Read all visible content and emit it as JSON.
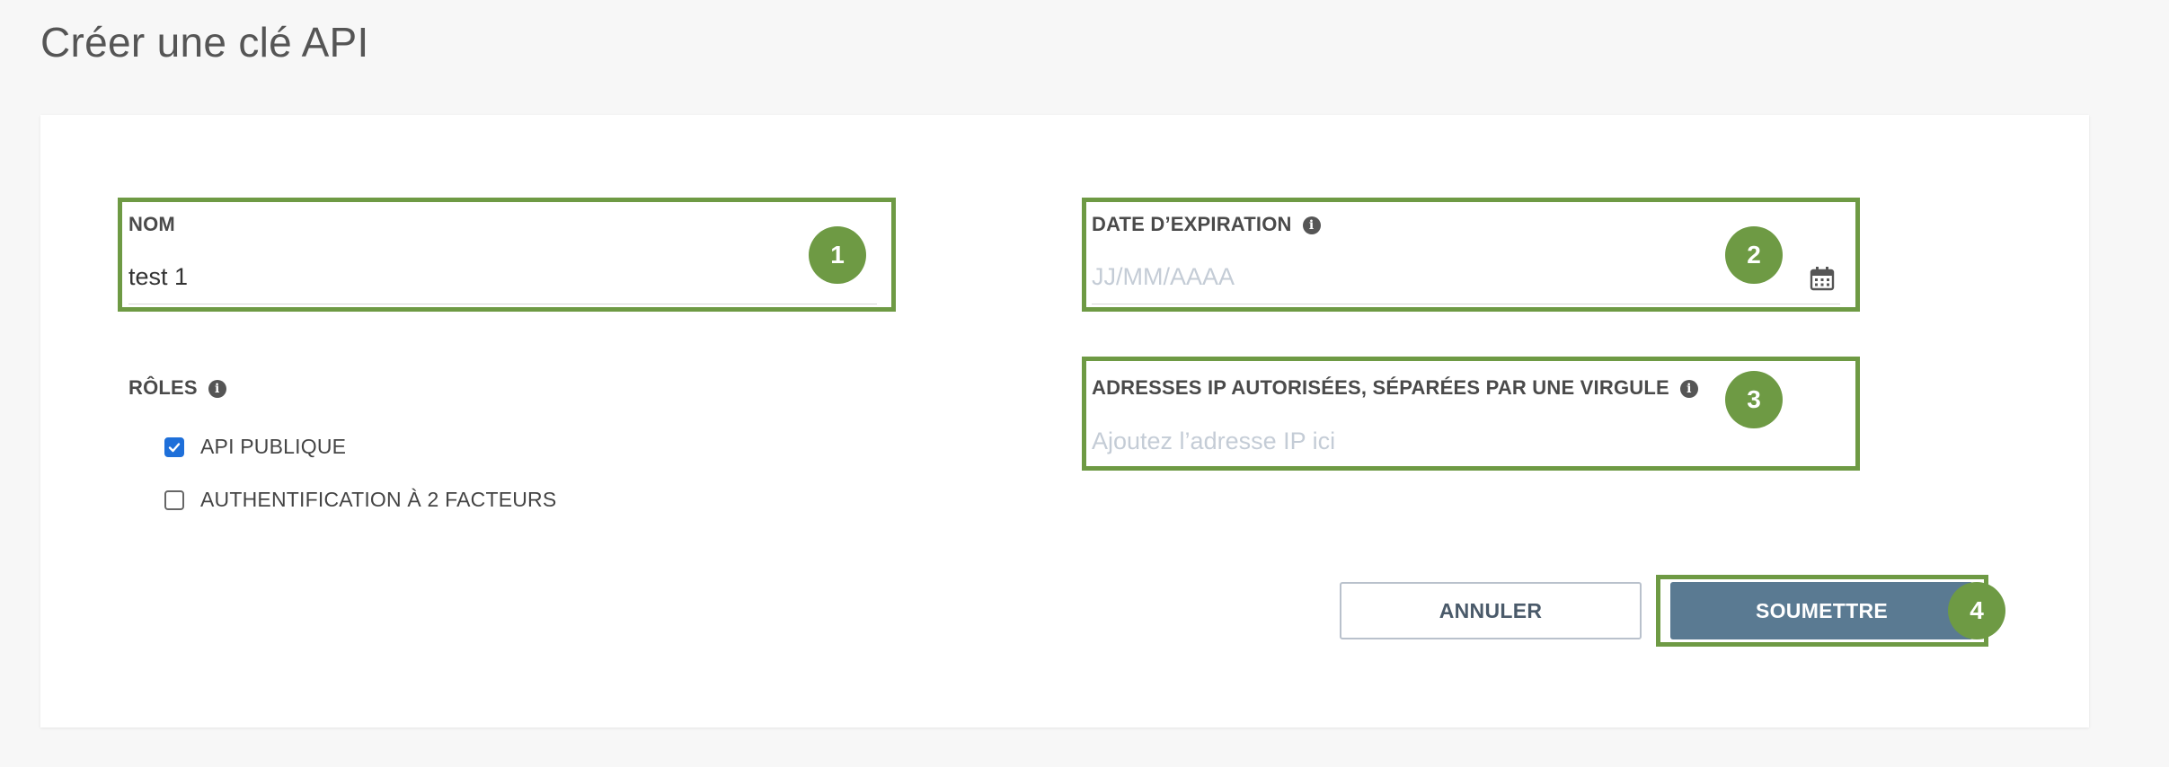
{
  "page": {
    "title": "Créer une clé API"
  },
  "form": {
    "name": {
      "label": "NOM",
      "value": "test 1"
    },
    "expiration": {
      "label": "DATE D’EXPIRATION",
      "placeholder": "JJ/MM/AAAA"
    },
    "roles": {
      "label": "RÔLES",
      "items": [
        {
          "label": "API PUBLIQUE",
          "checked": true
        },
        {
          "label": "AUTHENTIFICATION À 2 FACTEURS",
          "checked": false
        }
      ]
    },
    "ip": {
      "label": "ADRESSES IP AUTORISÉES, SÉPARÉES PAR UNE VIRGULE",
      "placeholder": "Ajoutez l’adresse IP ici"
    }
  },
  "actions": {
    "cancel_label": "ANNULER",
    "submit_label": "SOUMETTRE"
  },
  "annotations": {
    "badges": [
      "1",
      "2",
      "3",
      "4"
    ],
    "color": "#6e9a44"
  },
  "colors": {
    "submit_button": "#5a7a92",
    "checkbox_checked": "#1e6fd9",
    "annotation": "#6e9a44"
  },
  "icons": {
    "info": "info-icon",
    "calendar": "calendar-icon"
  }
}
